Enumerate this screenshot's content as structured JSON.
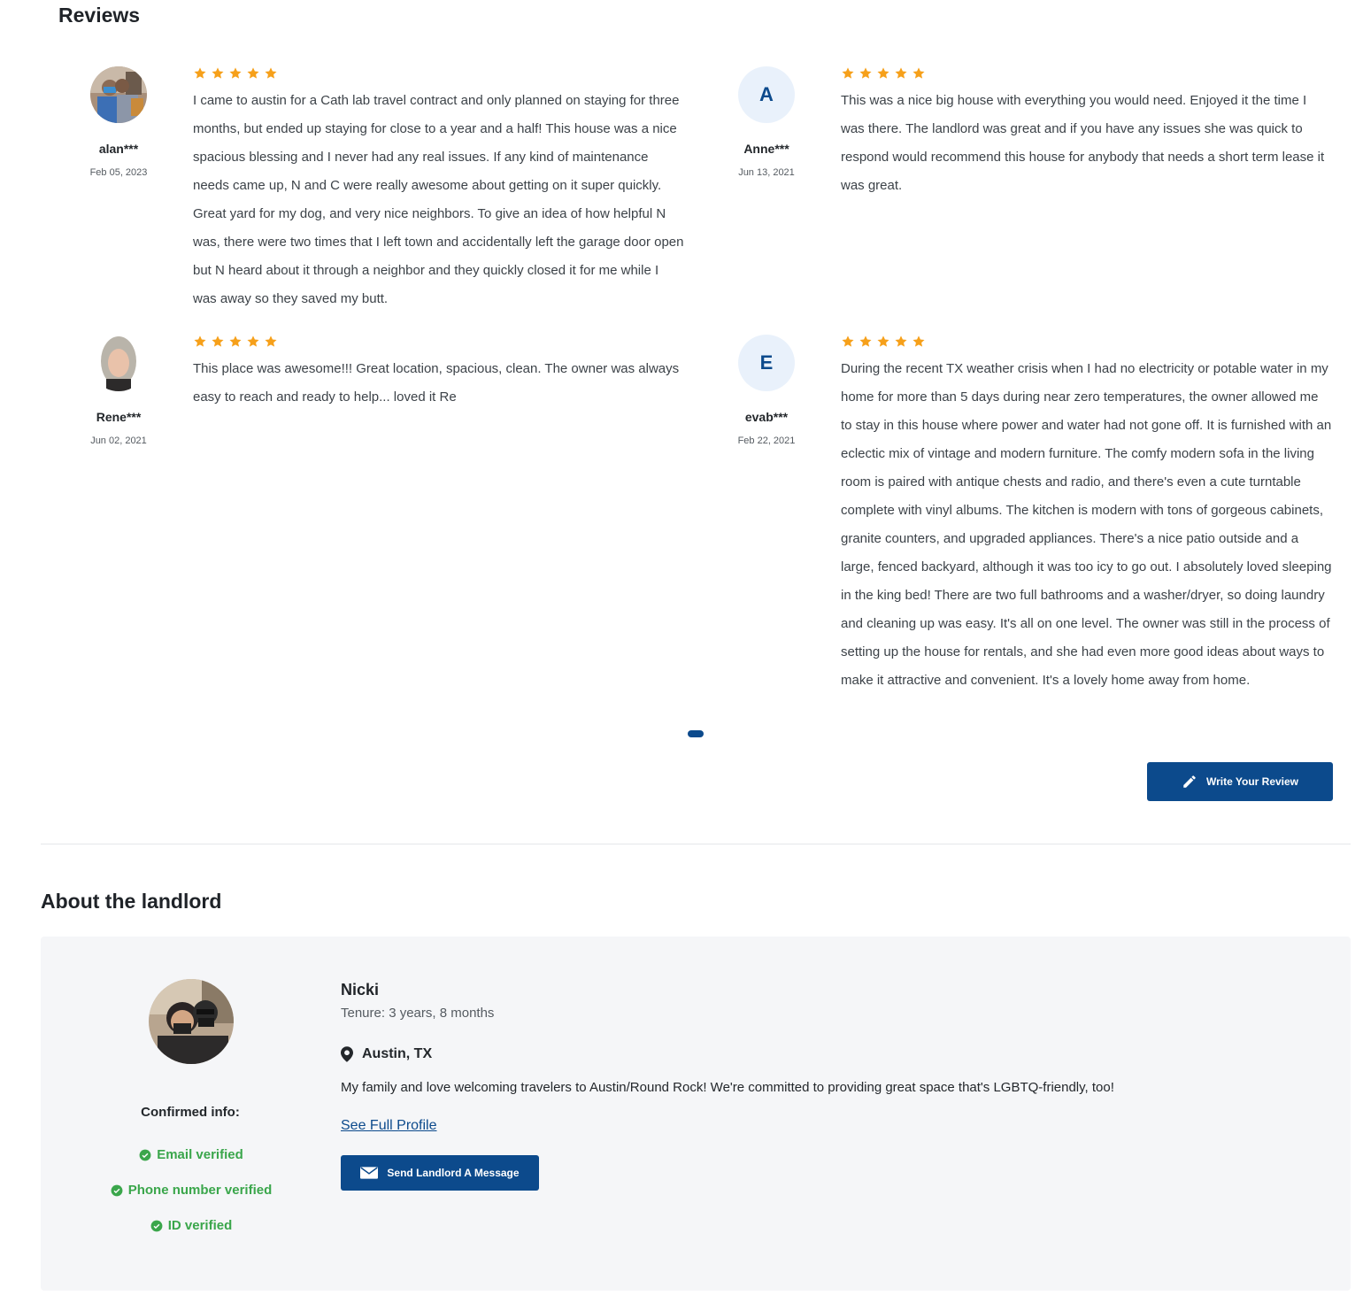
{
  "reviews_section": {
    "title": "Reviews",
    "reviews": [
      {
        "author": "alan***",
        "date": "Feb 05, 2023",
        "avatar": "photo",
        "rating": 5,
        "text": "I came to austin for a Cath lab travel contract and only planned on staying for three months, but ended up staying for close to a year and a half! This house was a nice spacious blessing and I never had any real issues. If any kind of maintenance needs came up, N and C were really awesome about getting on it super quickly. Great yard for my dog, and very nice neighbors. To give an idea of how helpful N was, there were two times that I left town and accidentally left the garage door open but N heard about it through a neighbor and they quickly closed it for me while I was away so they saved my butt."
      },
      {
        "author": "Anne***",
        "date": "Jun 13, 2021",
        "avatar_letter": "A",
        "rating": 5,
        "text": "This was a nice big house with everything you would need. Enjoyed it the time I was there. The landlord was great and if you have any issues she was quick to respond would recommend this house for anybody that needs a short term lease it was great."
      },
      {
        "author": "Rene***",
        "date": "Jun 02, 2021",
        "avatar": "photo",
        "rating": 5,
        "text": "This place was awesome!!! Great location, spacious, clean. The owner was always easy to reach and ready to help... loved it Re"
      },
      {
        "author": "evab***",
        "date": "Feb 22, 2021",
        "avatar_letter": "E",
        "rating": 5,
        "text": "During the recent TX weather crisis when I had no electricity or potable water in my home for more than 5 days during near zero temperatures, the owner allowed me to stay in this house where power and water had not gone off. It is furnished with an eclectic mix of vintage and modern furniture. The comfy modern sofa in the living room is paired with antique chests and radio, and there's even a cute turntable complete with vinyl albums. The kitchen is modern with tons of gorgeous cabinets, granite counters, and upgraded appliances. There's a nice patio outside and a large, fenced backyard, although it was too icy to go out. I absolutely loved sleeping in the king bed! There are two full bathrooms and a washer/dryer, so doing laundry and cleaning up was easy. It's all on one level. The owner was still in the process of setting up the house for rentals, and she had even more good ideas about ways to make it attractive and convenient. It's a lovely home away from home."
      }
    ],
    "write_review_label": "Write Your Review"
  },
  "landlord_section": {
    "title": "About the landlord",
    "name": "Nicki",
    "tenure": "Tenure: 3 years, 8 months",
    "location": "Austin, TX",
    "bio": "My family and love welcoming travelers to Austin/Round Rock! We're committed to providing great space that's LGBTQ-friendly, too!",
    "see_profile_label": "See Full Profile",
    "message_label": "Send Landlord A Message",
    "confirmed_title": "Confirmed info:",
    "verifications": [
      "Email verified",
      "Phone number verified",
      "ID verified"
    ]
  },
  "colors": {
    "brand": "#0c4a8c",
    "star": "#f6a01a",
    "verified": "#3aa64b",
    "card_bg": "#f5f6f8"
  },
  "icons": [
    "star-icon",
    "pencil-icon",
    "envelope-icon",
    "map-pin-icon",
    "check-circle-icon"
  ]
}
